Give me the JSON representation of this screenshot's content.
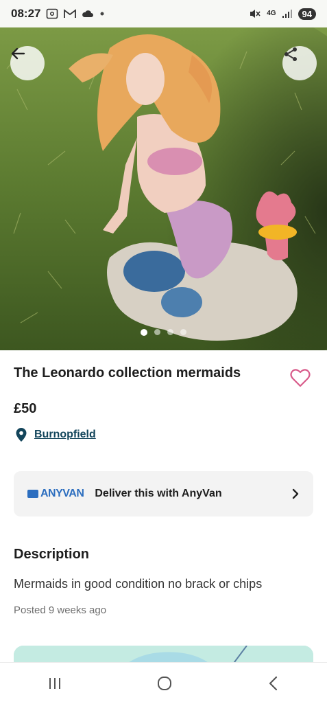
{
  "status_bar": {
    "time": "08:27",
    "network": "4G",
    "battery": "94",
    "icons": [
      "screenshot-icon",
      "gmail-icon",
      "cloud-icon",
      "dot-icon",
      "mute-icon",
      "signal-icon"
    ]
  },
  "hero": {
    "image_count": 4,
    "active_index": 0,
    "buttons": [
      "back-arrow-icon",
      "share-icon"
    ]
  },
  "listing": {
    "title": "The Leonardo collection mermaids",
    "price": "£50",
    "location": "Burnopfield",
    "favorite_icon": "heart-outline-icon"
  },
  "delivery": {
    "logo": "ANYVAN",
    "label": "Deliver this with AnyVan",
    "chevron": "chevron-right-icon"
  },
  "description": {
    "heading": "Description",
    "body": "Mermaids in good condition no brack or chips",
    "posted": "Posted 9 weeks ago"
  },
  "nav_bar": {
    "icons": [
      "recent-apps-icon",
      "home-icon",
      "back-icon"
    ]
  },
  "colors": {
    "accent_pink": "#d85b8a",
    "location_blue": "#13455b",
    "anyvan_blue": "#2c6ebf",
    "map_teal": "#bfe7de"
  }
}
